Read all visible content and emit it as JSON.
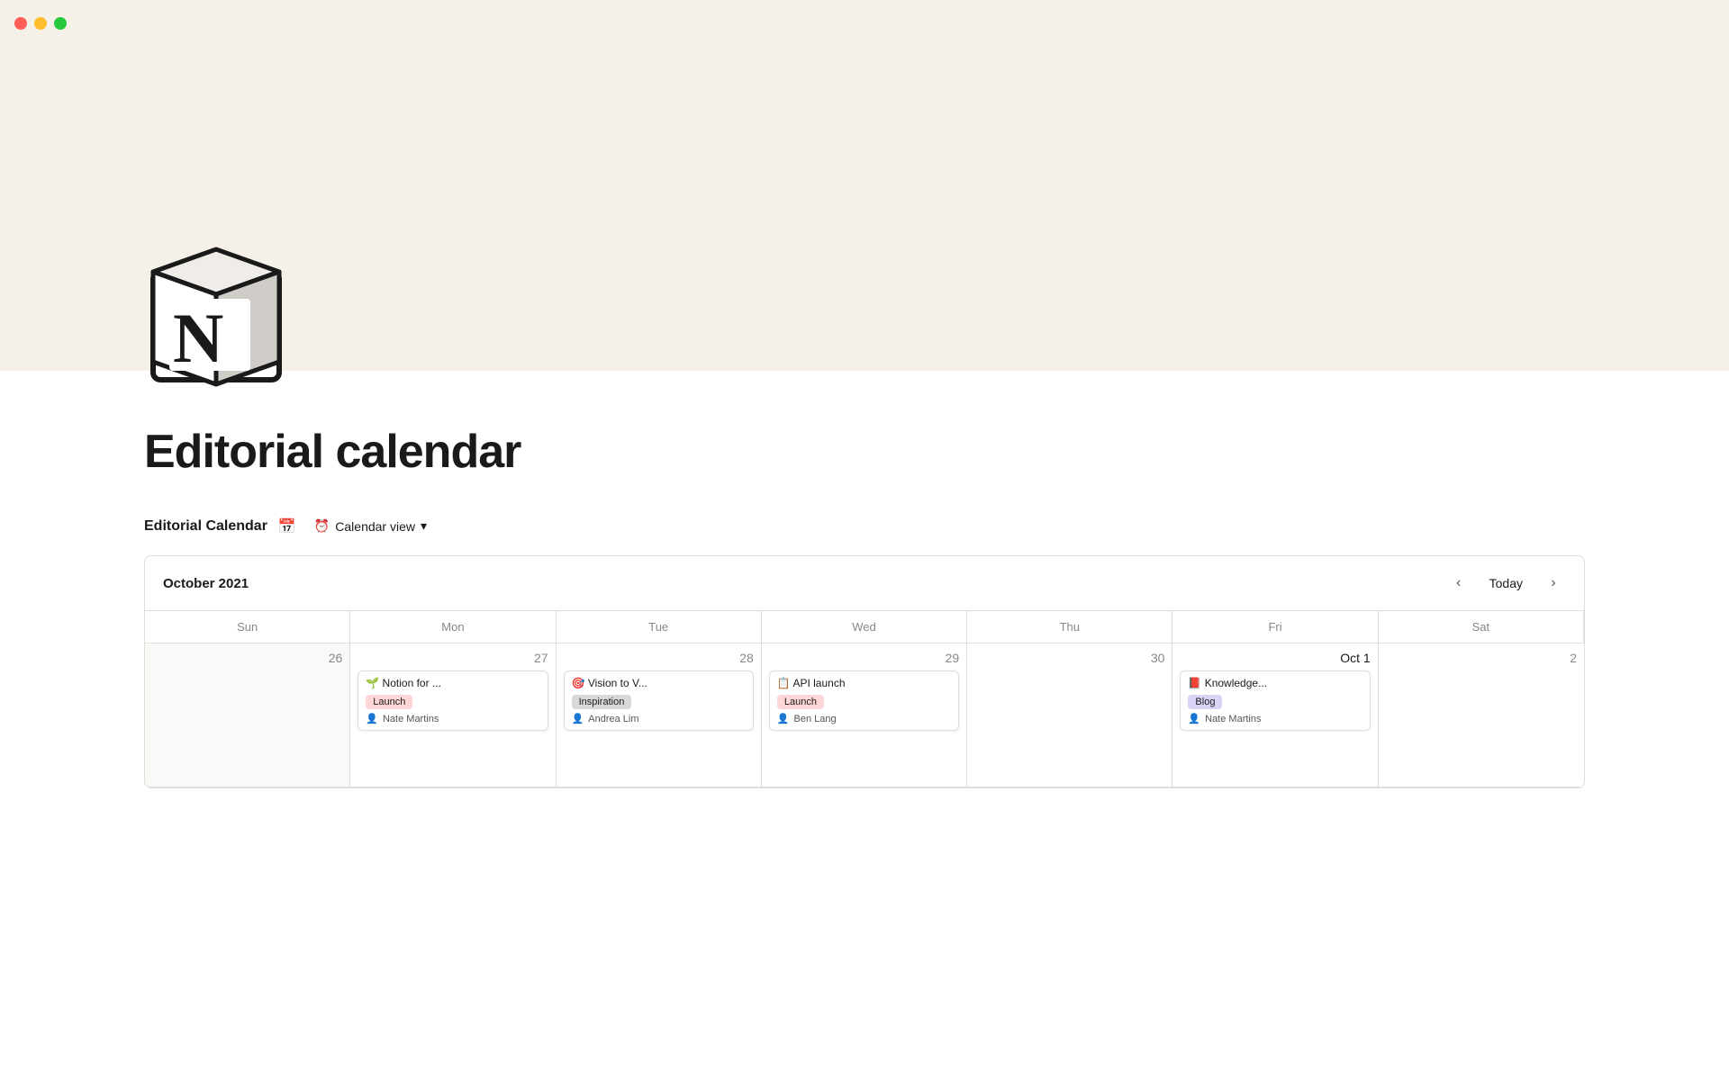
{
  "titlebar": {
    "traffic_lights": [
      "red",
      "yellow",
      "green"
    ]
  },
  "page": {
    "title": "Editorial calendar",
    "db_title": "Editorial Calendar",
    "db_icon": "📅",
    "view_icon": "⏰",
    "view_label": "Calendar view"
  },
  "calendar": {
    "month_label": "October 2021",
    "today_label": "Today",
    "nav_prev": "‹",
    "nav_next": "›",
    "day_headers": [
      "Sun",
      "Mon",
      "Tue",
      "Wed",
      "Thu",
      "Fri",
      "Sat"
    ],
    "weeks": [
      {
        "days": [
          {
            "num": "26",
            "outside": true,
            "today": false,
            "events": []
          },
          {
            "num": "27",
            "outside": false,
            "today": false,
            "events": [
              {
                "emoji": "🌱",
                "title": "Notion for ...",
                "tag": "Launch",
                "tag_class": "tag-launch",
                "author_icon": "👤",
                "author": "Nate Martins"
              }
            ]
          },
          {
            "num": "28",
            "outside": false,
            "today": true,
            "events": [
              {
                "emoji": "🎯",
                "title": "Vision to V...",
                "tag": "Inspiration",
                "tag_class": "tag-inspiration",
                "author_icon": "👤",
                "author": "Andrea Lim"
              }
            ]
          },
          {
            "num": "29",
            "outside": false,
            "today": false,
            "events": [
              {
                "emoji": "📋",
                "title": "API launch",
                "tag": "Launch",
                "tag_class": "tag-launch",
                "author_icon": "👤",
                "author": "Ben Lang"
              }
            ]
          },
          {
            "num": "30",
            "outside": false,
            "today": false,
            "events": []
          },
          {
            "num": "Oct 1",
            "outside": false,
            "today": false,
            "oct_first": true,
            "events": [
              {
                "emoji": "📕",
                "title": "Knowledge...",
                "tag": "Blog",
                "tag_class": "tag-blog",
                "author_icon": "👤",
                "author": "Nate Martins"
              }
            ]
          },
          {
            "num": "2",
            "outside": false,
            "today": false,
            "events": []
          }
        ]
      }
    ]
  }
}
